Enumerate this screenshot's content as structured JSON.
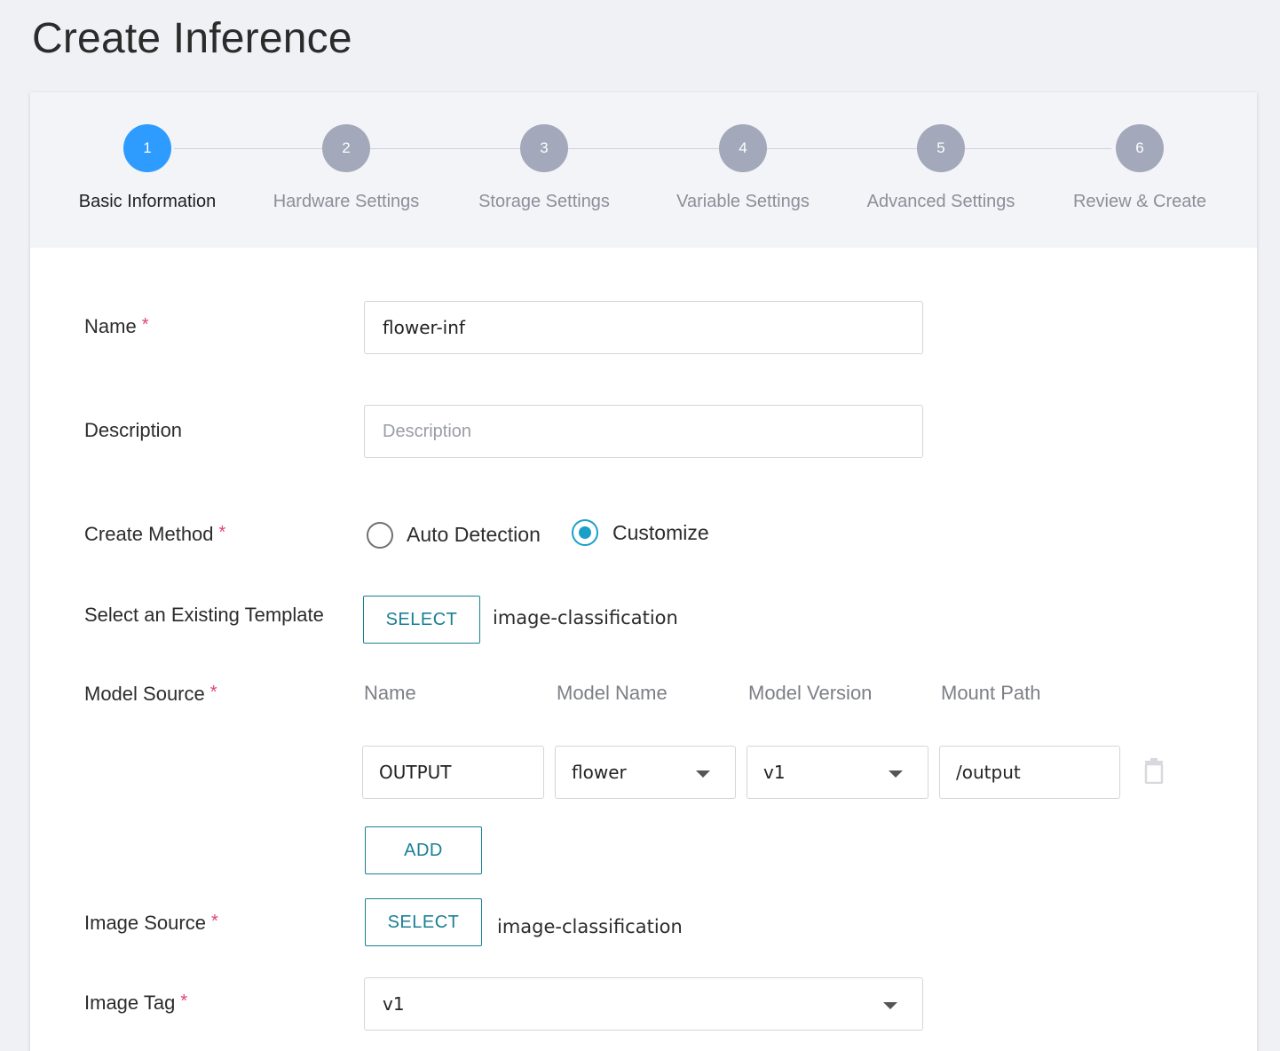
{
  "page": {
    "title": "Create Inference"
  },
  "stepper": {
    "steps": [
      {
        "num": "1",
        "label": "Basic Information",
        "active": true
      },
      {
        "num": "2",
        "label": "Hardware Settings",
        "active": false
      },
      {
        "num": "3",
        "label": "Storage Settings",
        "active": false
      },
      {
        "num": "4",
        "label": "Variable Settings",
        "active": false
      },
      {
        "num": "5",
        "label": "Advanced Settings",
        "active": false
      },
      {
        "num": "6",
        "label": "Review & Create",
        "active": false
      }
    ]
  },
  "form": {
    "name": {
      "label": "Name",
      "required": "*",
      "value": "flower-inf"
    },
    "description": {
      "label": "Description",
      "placeholder": "Description",
      "value": ""
    },
    "create_method": {
      "label": "Create Method",
      "required": "*",
      "options": [
        {
          "label": "Auto Detection",
          "checked": false
        },
        {
          "label": "Customize",
          "checked": true
        }
      ]
    },
    "template": {
      "label": "Select an Existing Template",
      "button": "SELECT",
      "value": "image-classification"
    },
    "model_source": {
      "label": "Model Source",
      "required": "*",
      "columns": [
        "Name",
        "Model Name",
        "Model Version",
        "Mount Path"
      ],
      "row": {
        "name": "OUTPUT",
        "model_name": "flower",
        "model_version": "v1",
        "mount_path": "/output"
      },
      "delete_icon": "trash-icon",
      "add_button": "ADD"
    },
    "image_source": {
      "label": "Image Source",
      "required": "*",
      "button": "SELECT",
      "value": "image-classification"
    },
    "image_tag": {
      "label": "Image Tag",
      "required": "*",
      "value": "v1"
    }
  },
  "colors": {
    "accent": "#2e9bff",
    "button_teal": "#1a7f95",
    "radio_teal": "#1aa0c8",
    "required": "#e0407a"
  }
}
